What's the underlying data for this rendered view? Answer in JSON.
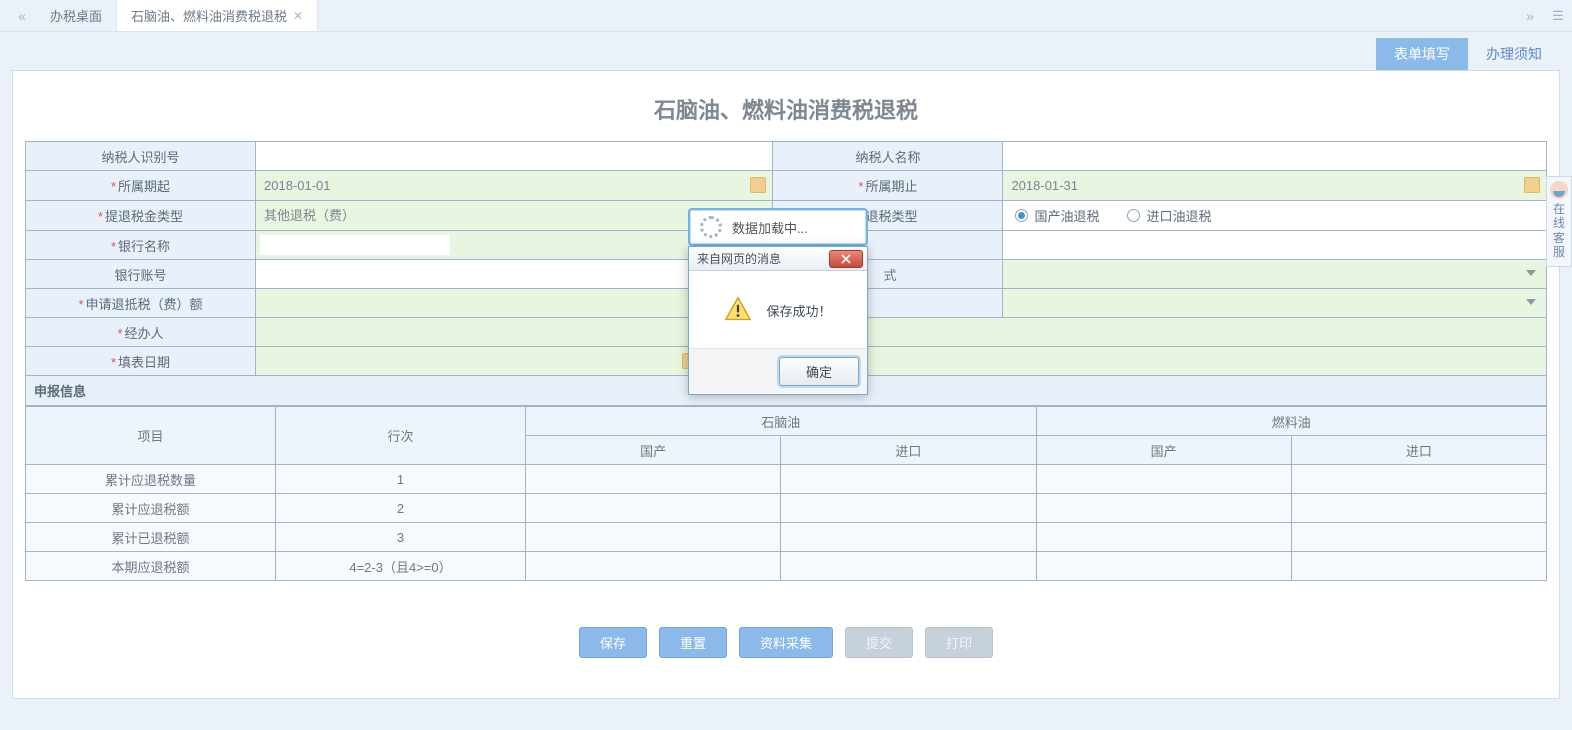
{
  "tabs": {
    "home": "办税桌面",
    "current": "石脑油、燃料油消费税退税"
  },
  "toolbar": {
    "form_fill": "表单填写",
    "notice": "办理须知"
  },
  "title": "石脑油、燃料油消费税退税",
  "labels": {
    "taxpayer_id": "纳税人识别号",
    "taxpayer_name": "纳税人名称",
    "period_from": "所属期起",
    "period_to": "所属期止",
    "refund_type": "提退税金类型",
    "tax_type": "退税类型",
    "bank_name": "银行名称",
    "bank_account": "银行账号",
    "apply_amount": "申请退抵税（费）额",
    "handler": "经办人",
    "fill_date": "填表日期"
  },
  "values": {
    "period_from": "2018-01-01",
    "period_to": "2018-01-31",
    "refund_type": "其他退税（费）",
    "tax_type_domestic": "国产油退税",
    "tax_type_import": "进口油退税",
    "hidden_col_suffix": "式"
  },
  "section_declare": "申报信息",
  "decl_headers": {
    "item": "项目",
    "row": "行次",
    "naphtha": "石脑油",
    "fueloil": "燃料油",
    "domestic": "国产",
    "import": "进口"
  },
  "decl_rows": [
    {
      "item": "累计应退税数量",
      "row": "1"
    },
    {
      "item": "累计应退税额",
      "row": "2"
    },
    {
      "item": "累计已退税额",
      "row": "3"
    },
    {
      "item": "本期应退税额",
      "row": "4=2-3（且4>=0）"
    }
  ],
  "buttons": {
    "save": "保存",
    "reset": "重置",
    "collect": "资料采集",
    "submit": "提交",
    "print": "打印"
  },
  "side": "在线客服",
  "loading": "数据加载中...",
  "msgbox": {
    "title": "来自网页的消息",
    "body": "保存成功！",
    "ok": "确定"
  }
}
